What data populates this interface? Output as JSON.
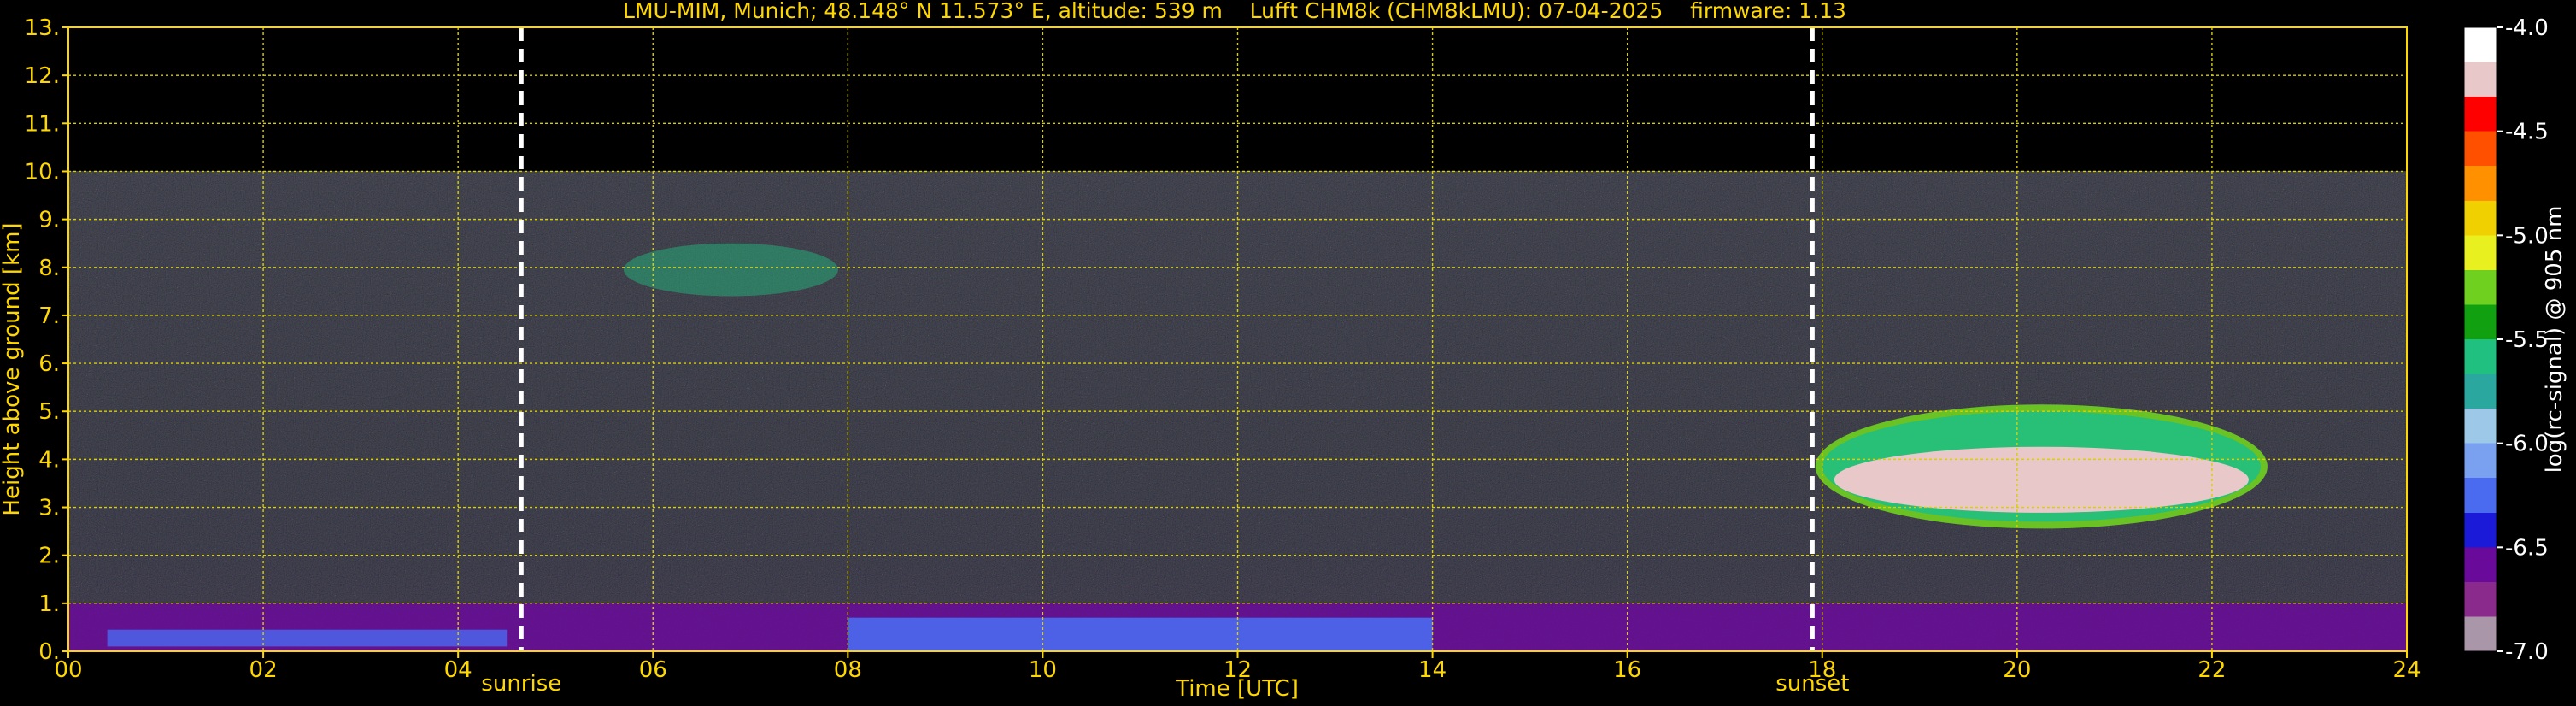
{
  "chart_data": {
    "type": "heatmap",
    "title": "LMU-MIM, Munich; 48.148° N 11.573° E, altitude: 539 m    Lufft CHM8k (CHM8kLMU): 07-04-2025    firmware: 1.13",
    "xlabel": "Time [UTC]",
    "ylabel": "Height above ground [km]",
    "xlim": [
      0,
      24
    ],
    "ylim": [
      0,
      13
    ],
    "x_ticks": [
      "00",
      "02",
      "04",
      "06",
      "08",
      "10",
      "12",
      "14",
      "16",
      "18",
      "20",
      "22",
      "24"
    ],
    "y_ticks": [
      "0.",
      "1.",
      "2.",
      "3.",
      "4.",
      "5.",
      "6.",
      "7.",
      "8.",
      "9.",
      "10.",
      "11.",
      "12.",
      "13."
    ],
    "grid": true,
    "data_top_km": 10,
    "markers": [
      {
        "label": "sunrise",
        "time": 4.65
      },
      {
        "label": "sunset",
        "time": 17.9
      }
    ],
    "features": [
      {
        "name": "boundary layer",
        "start": 0,
        "end": 24,
        "bottom": 0,
        "top": 1.0,
        "level": -6.6
      },
      {
        "name": "cirrus",
        "start": 5.7,
        "end": 7.9,
        "bottom": 7.4,
        "top": 8.5,
        "level": -5.6
      },
      {
        "name": "cloud",
        "start": 18.0,
        "end": 22.5,
        "bottom": 2.7,
        "top": 5.0,
        "level": -4.2
      }
    ],
    "colorbar": {
      "label": "log(rc-signal) @ 905 nm",
      "range": [
        -7.0,
        -4.0
      ],
      "ticks": [
        "-4.0",
        "-4.5",
        "-5.0",
        "-5.5",
        "-6.0",
        "-6.5",
        "-7.0"
      ],
      "colors": [
        "#a996a8",
        "#8a2a8c",
        "#6a0a9a",
        "#1a1ad8",
        "#4a6af0",
        "#7aa0f0",
        "#9ec8e8",
        "#2aa8a0",
        "#20c080",
        "#10a010",
        "#70d020",
        "#e8f020",
        "#f0d000",
        "#ff9000",
        "#ff5000",
        "#ff0000",
        "#e8c8c8",
        "#ffffff"
      ]
    }
  }
}
